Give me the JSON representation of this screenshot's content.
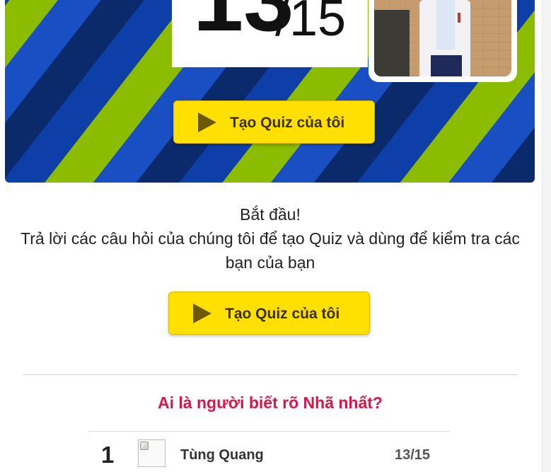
{
  "result": {
    "score": "13",
    "total": "/15"
  },
  "buttons": {
    "create_quiz_label": "Tạo Quiz của tôi",
    "icon": "play-icon"
  },
  "intro": {
    "line1": "Bắt đầu!",
    "line2": "Trả lời các câu hỏi của chúng tôi để tạo Quiz và dùng để kiểm tra các bạn của bạn"
  },
  "leaderboard": {
    "title": "Ai là người biết rõ Nhã nhất?",
    "rows": [
      {
        "rank": "1",
        "name": "Tùng Quang",
        "score": "13/15"
      }
    ]
  },
  "colors": {
    "button": "#ffe000",
    "leader_title": "#d8164a",
    "stripe_navy": "#0a2a6b",
    "stripe_blue": "#1a4fc4",
    "stripe_green": "#8cbc00"
  }
}
